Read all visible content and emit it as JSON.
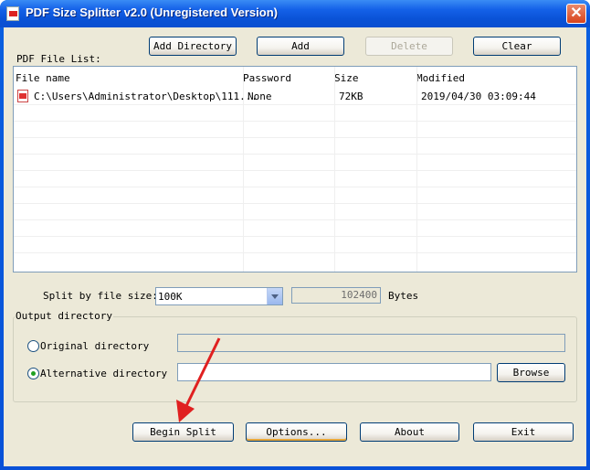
{
  "window": {
    "title": "PDF Size Splitter v2.0 (Unregistered Version)",
    "close_glyph": "✕"
  },
  "toolbar": {
    "add_directory": "Add Directory",
    "add": "Add",
    "delete": "Delete",
    "clear": "Clear"
  },
  "file_list": {
    "label": "PDF File List:",
    "columns": [
      "File name",
      "Password",
      "Size",
      "Modified"
    ],
    "rows": [
      {
        "icon": "pdf-file-icon",
        "file_name": "C:\\Users\\Administrator\\Desktop\\111...",
        "password": "None",
        "size": "72KB",
        "modified": "2019/04/30 03:09:44"
      }
    ]
  },
  "split": {
    "label": "Split by file size:",
    "selected": "100K",
    "bytes_value": "102400",
    "bytes_unit": "Bytes"
  },
  "output": {
    "group_label": "Output directory",
    "original_label": "Original directory",
    "original_value": "",
    "alternative_label": "Alternative directory",
    "alternative_value": "",
    "selected": "alternative",
    "browse": "Browse"
  },
  "actions": {
    "begin_split": "Begin Split",
    "options": "Options...",
    "about": "About",
    "exit": "Exit"
  },
  "colors": {
    "titlebar": "#0a52d6",
    "dialog_bg": "#ece9d8",
    "annotation_arrow": "#e02020"
  }
}
